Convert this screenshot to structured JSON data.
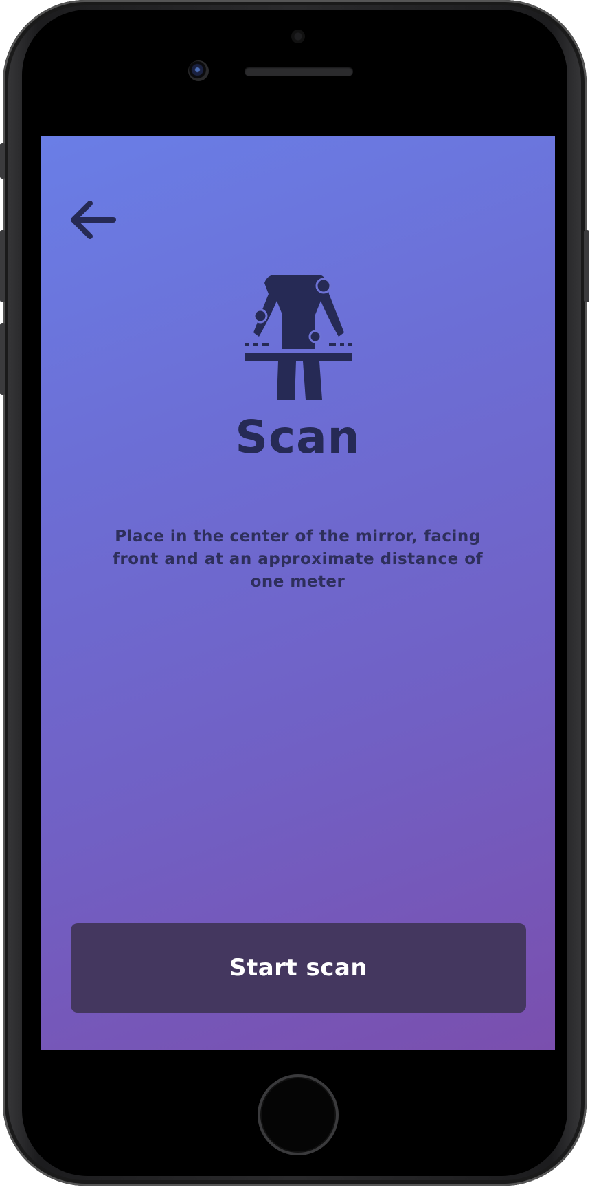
{
  "screen": {
    "back_icon": "arrow-left-icon",
    "hero_icon": "body-scan-icon",
    "title": "Scan",
    "description": "Place in the center of the mirror, facing front and at an approximate distance of one meter",
    "start_button_label": "Start scan"
  },
  "colors": {
    "gradient_start": "#6a7ee6",
    "gradient_end": "#7a4fae",
    "text_dark": "#262a55",
    "button_bg": "#44375f",
    "button_text": "#ffffff"
  }
}
